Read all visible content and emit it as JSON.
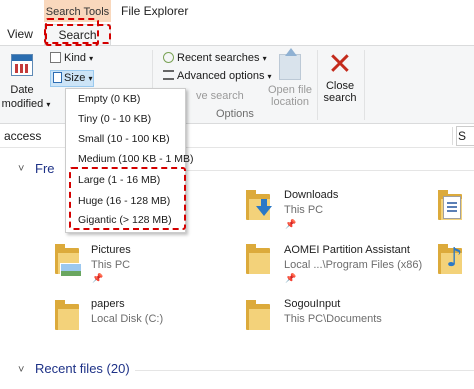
{
  "window": {
    "title": "File Explorer",
    "context_tab": "Search Tools"
  },
  "tabs": [
    {
      "label": "View"
    },
    {
      "label": "Search"
    }
  ],
  "ribbon": {
    "date_modified": {
      "line1": "Date",
      "line2": "modified"
    },
    "kind": "Kind",
    "size": "Size",
    "recent_searches": "Recent searches",
    "advanced_options": "Advanced options",
    "save_search": "ve search",
    "open_file_location": {
      "line1": "Open file",
      "line2": "location"
    },
    "close_search": {
      "line1": "Close",
      "line2": "search"
    },
    "options_group": "Options"
  },
  "size_menu": {
    "items": [
      "Empty (0 KB)",
      "Tiny (0 - 10 KB)",
      "Small (10 - 100 KB)",
      "Medium (100 KB - 1 MB)",
      "Large (1 - 16 MB)",
      "Huge (16 - 128 MB)",
      "Gigantic (> 128 MB)"
    ]
  },
  "address": {
    "text": "access",
    "search_text": "S"
  },
  "quick_access": {
    "section_title": "Fre",
    "items": [
      {
        "name": "Downloads",
        "location": "This PC"
      },
      {
        "name": "Pictures",
        "location": "This PC"
      },
      {
        "name": "AOMEI Partition Assistant",
        "location": "Local ...\\Program Files (x86)"
      },
      {
        "name": "papers",
        "location": "Local Disk (C:)"
      },
      {
        "name": "SogouInput",
        "location": "This PC\\Documents"
      }
    ]
  },
  "recent_files": {
    "section_title": "Recent files (20)"
  },
  "colors": {
    "highlight": "#d40000",
    "context_tab": "#f9d8bd",
    "section_title": "#1e3287",
    "folder": "#dcaa3b"
  }
}
